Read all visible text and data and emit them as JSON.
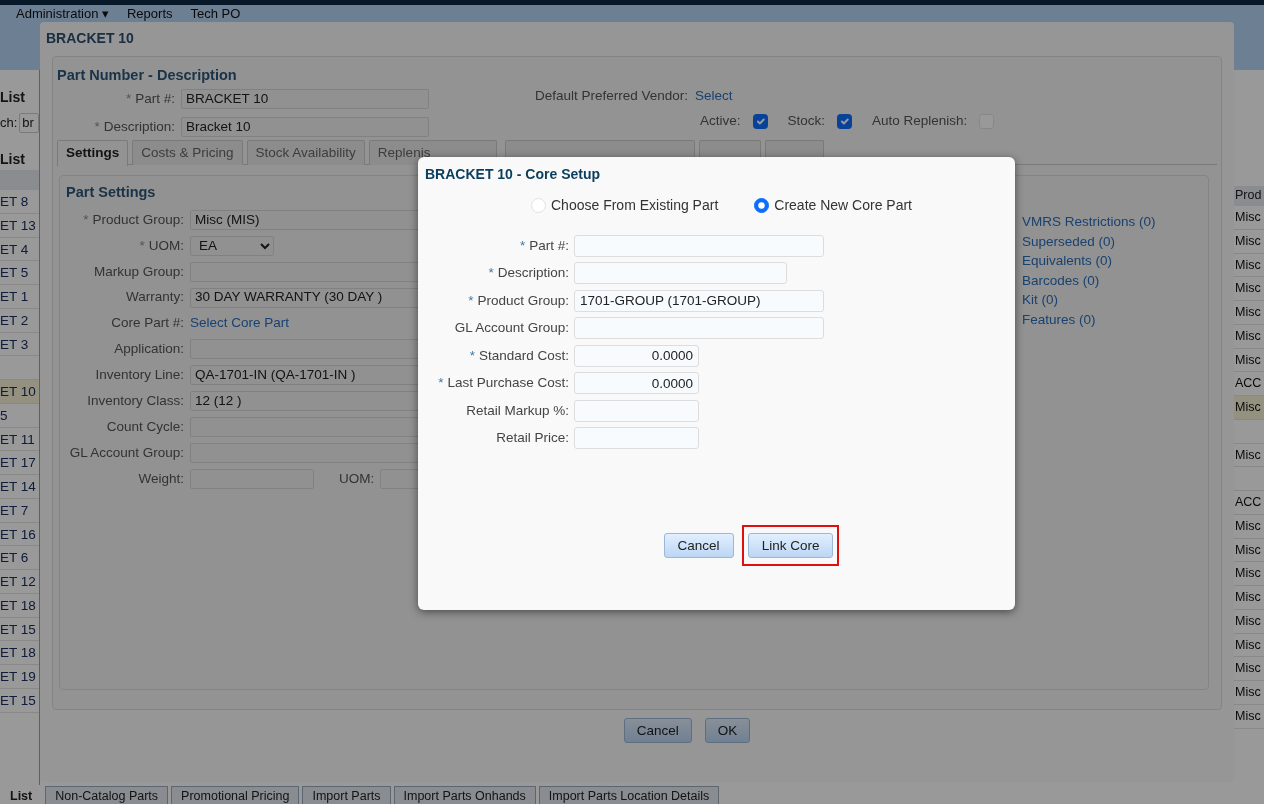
{
  "top_menu": [
    {
      "label": "Administration ▾"
    },
    {
      "label": "Reports"
    },
    {
      "label": "Tech PO"
    }
  ],
  "left_panel": {
    "title": "List",
    "search_label": "ch:",
    "search_value": "br",
    "list_title": "List"
  },
  "table": {
    "column_2_header": "Prod",
    "rows": [
      {
        "column_1": "ET 8",
        "column_2": "Misc",
        "selected": false
      },
      {
        "column_1": "ET 13",
        "column_2": "Misc",
        "selected": false
      },
      {
        "column_1": "ET 4",
        "column_2": "Misc",
        "selected": false
      },
      {
        "column_1": "ET 5",
        "column_2": "Misc",
        "selected": false
      },
      {
        "column_1": "ET 1",
        "column_2": "Misc",
        "selected": false
      },
      {
        "column_1": "ET 2",
        "column_2": "Misc",
        "selected": false
      },
      {
        "column_1": "ET 3",
        "column_2": "Misc",
        "selected": false
      },
      {
        "column_2": "ACC",
        "selected": false
      },
      {
        "column_1": "ET 10",
        "column_2": "Misc",
        "selected": true
      },
      {
        "column_1": "5",
        "selected": false
      },
      {
        "column_1": "ET 11",
        "column_2": "Misc",
        "selected": false
      },
      {
        "column_1": "ET 17",
        "selected": false
      },
      {
        "column_1": "ET 14",
        "column_2": "ACC",
        "selected": false
      },
      {
        "column_1": "ET 7",
        "column_2": "Misc",
        "selected": false
      },
      {
        "column_1": "ET 16",
        "column_2": "Misc",
        "selected": false
      },
      {
        "column_1": "ET 6",
        "column_2": "Misc",
        "selected": false
      },
      {
        "column_1": "ET 12",
        "column_2": "Misc",
        "selected": false
      },
      {
        "column_1": "ET 18",
        "column_2": "Misc",
        "selected": false
      },
      {
        "column_1": "ET 15",
        "column_2": "Misc",
        "selected": false
      },
      {
        "column_1": "ET 18",
        "column_2": "Misc",
        "selected": false
      },
      {
        "column_1": "ET 19",
        "column_2": "Misc",
        "selected": false
      },
      {
        "column_1": "ET 15",
        "column_2": "Misc",
        "selected": false
      }
    ]
  },
  "part_dialog": {
    "title": "BRACKET 10",
    "section_title": "Part Number - Description",
    "fields": [
      {
        "mark": "*",
        "label": "Part #:",
        "value": "BRACKET 10"
      },
      {
        "mark": "*",
        "label": "Description:",
        "value": "Bracket 10"
      }
    ],
    "vendor_label": "Default Preferred Vendor:",
    "vendor_link": "Select",
    "flags": [
      {
        "label": "Active:",
        "checked": true
      },
      {
        "label": "Stock:",
        "checked": true
      },
      {
        "label": "Auto Replenish:",
        "checked": false
      }
    ],
    "tabs": [
      {
        "label": "Settings",
        "selected": true
      },
      {
        "label": "Costs & Pricing",
        "selected": false
      },
      {
        "label": "Stock Availability",
        "selected": false
      },
      {
        "label": "Replenis",
        "selected": false
      },
      {
        "selected": false
      },
      {
        "selected": false
      },
      {
        "selected": false
      }
    ],
    "settings_title": "Part Settings",
    "settings": [
      {
        "kind": "text",
        "mark": "*",
        "label": "Product Group:",
        "value": "Misc (MIS)"
      },
      {
        "kind": "select",
        "mark": "*",
        "label": "UOM:",
        "value": "EA"
      },
      {
        "kind": "text",
        "label": "Markup Group:"
      },
      {
        "kind": "text",
        "label": "Warranty:",
        "value": "30 DAY WARRANTY (30 DAY )"
      },
      {
        "kind": "link",
        "label": "Core Part #:",
        "value": "Select Core Part"
      },
      {
        "kind": "text",
        "label": "Application:"
      },
      {
        "kind": "text",
        "label": "Inventory Line:",
        "value": "QA-1701-IN (QA-1701-IN )"
      },
      {
        "kind": "text",
        "label": "Inventory Class:",
        "value": "12 (12 )"
      },
      {
        "kind": "text",
        "label": "Count Cycle:"
      },
      {
        "kind": "text",
        "label": "GL Account Group:"
      },
      {
        "kind": "weight",
        "label": "Weight:",
        "unit_label": "UOM:"
      }
    ],
    "related_links": [
      "VMRS Restrictions (0)",
      "Superseded (0)",
      "Equivalents (0)",
      "Barcodes (0)",
      "Kit (0)",
      "Features (0)"
    ],
    "buttons": [
      {
        "label": "Cancel"
      },
      {
        "label": "OK"
      }
    ]
  },
  "core_setup_dialog": {
    "title": "BRACKET 10 - Core Setup",
    "options": [
      {
        "label": "Choose From Existing Part",
        "selected": false
      },
      {
        "label": "Create New Core Part",
        "selected": true
      }
    ],
    "fields": [
      {
        "kind": "text",
        "mark": "*",
        "label": "Part #:"
      },
      {
        "kind": "text",
        "mark": "*",
        "label": "Description:"
      },
      {
        "kind": "select",
        "mark": "*",
        "label": "Product Group:",
        "value": "1701-GROUP (1701-GROUP)"
      },
      {
        "kind": "select",
        "label": "GL Account Group:"
      },
      {
        "kind": "number",
        "mark": "*",
        "label": "Standard Cost:",
        "value": "0.0000"
      },
      {
        "kind": "number",
        "mark": "*",
        "label": "Last Purchase Cost:",
        "value": "0.0000"
      },
      {
        "kind": "number",
        "label": "Retail Markup %:"
      },
      {
        "kind": "number",
        "label": "Retail Price:"
      }
    ],
    "buttons": [
      {
        "label": "Cancel",
        "highlighted": false
      },
      {
        "label": "Link Core",
        "highlighted": true
      }
    ]
  },
  "bottom_tabs": [
    {
      "label": "List",
      "selected": true
    },
    {
      "label": "Non-Catalog Parts",
      "selected": false
    },
    {
      "label": "Promotional Pricing",
      "selected": false
    },
    {
      "label": "Import Parts",
      "selected": false
    },
    {
      "label": "Import Parts Onhands",
      "selected": false
    },
    {
      "label": "Import Parts Location Details",
      "selected": false
    }
  ]
}
